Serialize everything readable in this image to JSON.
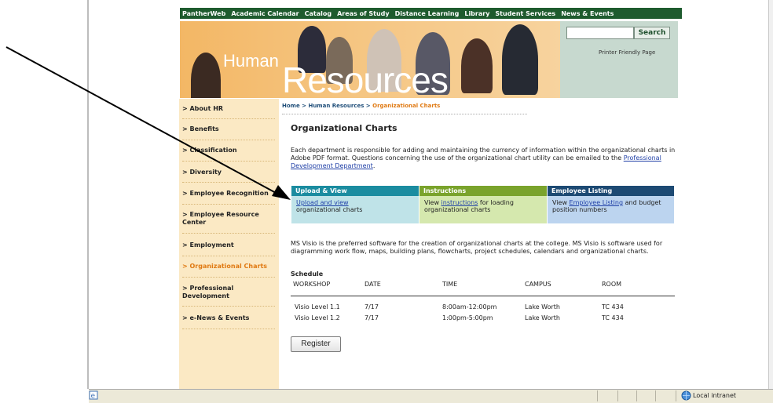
{
  "topnav": [
    "PantherWeb",
    "Academic Calendar",
    "Catalog",
    "Areas of Study",
    "Distance Learning",
    "Library",
    "Student Services",
    "News & Events"
  ],
  "banner": {
    "title_small": "Human",
    "title_large": "Resources"
  },
  "search": {
    "button": "Search",
    "value": ""
  },
  "printer_link": "Printer Friendly Page",
  "leftnav": [
    {
      "label": "> About HR"
    },
    {
      "label": "> Benefits"
    },
    {
      "label": "> Classification"
    },
    {
      "label": "> Diversity"
    },
    {
      "label": "> Employee Recognition"
    },
    {
      "label": "> Employee Resource Center"
    },
    {
      "label": "> Employment"
    },
    {
      "label": "> Organizational Charts"
    },
    {
      "label": "> Professional Development"
    },
    {
      "label": "> e-News & Events"
    }
  ],
  "breadcrumb": {
    "home": "Home",
    "sep": " > ",
    "section": "Human Resources",
    "current": "Organizational Charts"
  },
  "page_title": "Organizational Charts",
  "intro": {
    "text": "Each department is responsible for adding and maintaining the currency of information within the organizational charts in Adobe PDF format. Questions concerning the use of the organizational chart utility can be emailed to the ",
    "link": "Professional Development Department",
    "end": "."
  },
  "boxes": [
    {
      "header": "Upload & View",
      "link": "Upload and view",
      "text_before": "",
      "text_after": " organizational charts",
      "header_color": "#1b8ca0",
      "body_color": "#bfe3e8"
    },
    {
      "header": "Instructions",
      "link": "instructions",
      "text_before": "View ",
      "text_after": " for loading organizational charts",
      "header_color": "#7aa32c",
      "body_color": "#d5e8ae"
    },
    {
      "header": "Employee Listing",
      "link": "Employee Listing",
      "text_before": "View ",
      "text_after": " and budget position numbers",
      "header_color": "#1d4a73",
      "body_color": "#bcd4ef"
    }
  ],
  "para2": "MS Visio is the preferred software for the creation of organizational charts at the college. MS Visio is software used for diagramming work flow, maps, building plans, flowcharts, project schedules, calendars and organizational charts.",
  "schedule": {
    "title": "Schedule",
    "headers": [
      "WORKSHOP",
      "DATE",
      "TIME",
      "CAMPUS",
      "ROOM"
    ],
    "rows": [
      [
        "Visio Level 1.1",
        "7/17",
        "8:00am-12:00pm",
        "Lake Worth",
        "TC 434"
      ],
      [
        "Visio Level 1.2",
        "7/17",
        "1:00pm-5:00pm",
        "Lake Worth",
        "TC 434"
      ]
    ]
  },
  "register_button": "Register",
  "statusbar": {
    "zone": "Local intranet",
    "page_icon": "ie-page-icon",
    "zone_icon": "intranet-globe-icon"
  },
  "annotation": {
    "arrow_icon": "annotation-arrow-icon"
  }
}
